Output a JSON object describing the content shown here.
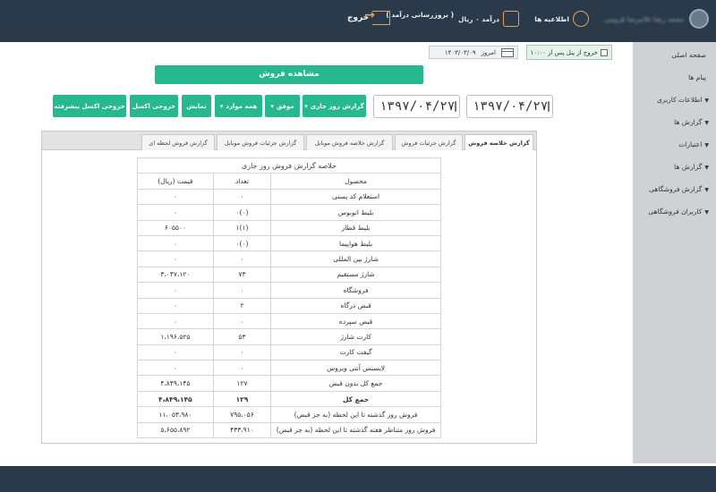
{
  "header": {
    "user_name": "محمد رضا غلامرضا قزوینی",
    "notifications": "اطلاعیه ها",
    "income": "درآمد ۰ ریال",
    "update_income": "( بروزرسانی درآمد )",
    "logout": "خروج"
  },
  "top_strip": {
    "auto_exit": "خروج از پنل پس از ۱۰:۰۰",
    "today_label": "امروز",
    "today_date": "۱۴۰۳/۰۳/۰۹"
  },
  "page_title": "مشاهده فروش",
  "toolbar": {
    "date_from": "۱۳۹۷/۰۴/۲۷",
    "date_to": "۱۳۹۷/۰۴/۲۷",
    "report_type": "گزارش روز جاری",
    "status": "موفق",
    "all_items": "همه موارد",
    "show": "نمایش",
    "excel": "خروجی اکسل",
    "excel_advanced": "خروجی اکسل پیشرفته"
  },
  "tabs": [
    "گزارش خلاصه فروش",
    "گزارش جزئیات فروش",
    "گزارش خلاصه فروش موبایل",
    "گزارش جزئیات فروش موبایل",
    "گزارش فروش لحظه ای"
  ],
  "sidebar": [
    {
      "label": "صفحه اصلی",
      "caret": ""
    },
    {
      "label": "پیام ها",
      "caret": ""
    },
    {
      "label": "اطلاعات کاربری",
      "caret": "▼"
    },
    {
      "label": "گزارش ها",
      "caret": "▼"
    },
    {
      "label": "اعتبارات",
      "caret": "▼"
    },
    {
      "label": "گزارش ها",
      "caret": "▼"
    },
    {
      "label": "گزارش فروشگاهی",
      "caret": "▼"
    },
    {
      "label": "کاربران فروشگاهی",
      "caret": "▼"
    }
  ],
  "report": {
    "caption": "خلاصه گزارش فروش روز جاری",
    "headers": [
      "محصول",
      "تعداد",
      "قیمت (ریال)"
    ],
    "rows": [
      [
        "استعلام کد پستی",
        "۰",
        "۰"
      ],
      [
        "بلیط اتوبوس",
        "(۰)۰",
        "۰"
      ],
      [
        "بلیط قطار",
        "(۱)۱",
        "۶۰۵۵۰۰"
      ],
      [
        "بلیط هواپیما",
        "(۰)۰",
        "۰"
      ],
      [
        "شارژ بین المللی",
        "۰",
        "۰"
      ],
      [
        "شارژ مستقیم",
        "۷۳",
        "۳،۰۴۷،۱۲۰"
      ],
      [
        "فروشگاه",
        "۰",
        "۰"
      ],
      [
        "قبض درگاه",
        "۲",
        "۰"
      ],
      [
        "قبض سپرده",
        "۰",
        "۰"
      ],
      [
        "کارت شارژ",
        "۵۳",
        "۱،۱۹۶،۵۲۵"
      ],
      [
        "گیفت کارت",
        "۰",
        "۰"
      ],
      [
        "لایسنس آنتی ویروس",
        "۰",
        "۰"
      ],
      [
        "جمع کل بدون قبض",
        "۱۲۷",
        "۴،۸۴۹،۱۴۵"
      ],
      [
        "جمع کل",
        "۱۲۹",
        "۴،۸۴۹،۱۴۵"
      ],
      [
        "فروش روز گذشته تا این لحظه (به جز قبض)",
        "۷۹۵،۰۵۶",
        "۱۱،۰۵۳،۹۸۰"
      ],
      [
        "فروش روز متناظر هفته گذشته تا این لحظه (به جز قبض)",
        "۴۳۳،۹۱۰",
        "۵،۶۵۵،۸۹۲"
      ]
    ]
  }
}
